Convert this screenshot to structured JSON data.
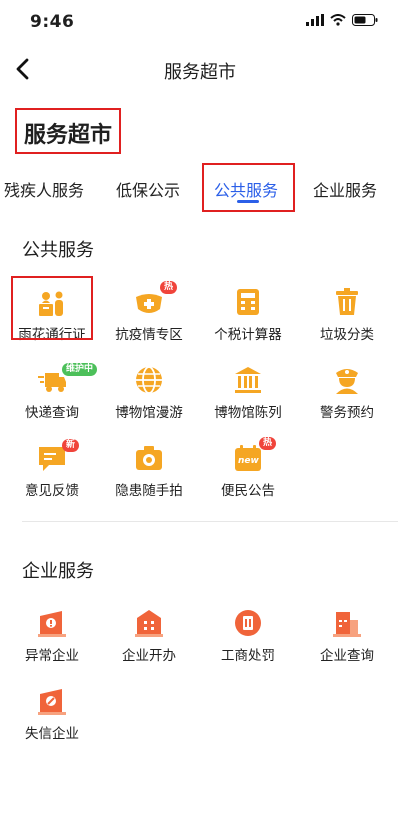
{
  "status": {
    "time": "9:46"
  },
  "nav": {
    "title": "服务超市"
  },
  "page": {
    "title": "服务超市"
  },
  "tabs": [
    {
      "label": "残疾人服务"
    },
    {
      "label": "低保公示"
    },
    {
      "label": "公共服务"
    },
    {
      "label": "企业服务"
    }
  ],
  "public": {
    "title": "公共服务",
    "items": [
      {
        "label": "雨花通行证",
        "icon": "pass-icon"
      },
      {
        "label": "抗疫情专区",
        "icon": "epidemic-icon",
        "badge": "热"
      },
      {
        "label": "个税计算器",
        "icon": "calculator-icon"
      },
      {
        "label": "垃圾分类",
        "icon": "trash-icon"
      },
      {
        "label": "快递查询",
        "icon": "delivery-icon",
        "badge": "维护中"
      },
      {
        "label": "博物馆漫游",
        "icon": "globe-icon"
      },
      {
        "label": "博物馆陈列",
        "icon": "museum-icon"
      },
      {
        "label": "警务预约",
        "icon": "police-icon"
      },
      {
        "label": "意见反馈",
        "icon": "feedback-icon",
        "badge": "新"
      },
      {
        "label": "隐患随手拍",
        "icon": "camera-icon"
      },
      {
        "label": "便民公告",
        "icon": "notice-icon",
        "badge": "热",
        "subbadge": "new"
      }
    ]
  },
  "enterprise": {
    "title": "企业服务",
    "items": [
      {
        "label": "异常企业",
        "icon": "alert-building-icon"
      },
      {
        "label": "企业开办",
        "icon": "building-icon"
      },
      {
        "label": "工商处罚",
        "icon": "penalty-icon"
      },
      {
        "label": "企业查询",
        "icon": "search-building-icon"
      },
      {
        "label": "失信企业",
        "icon": "dishonest-icon"
      }
    ]
  },
  "colors": {
    "accent": "#2b5fe8",
    "orange": "#f5a623",
    "deepOrange": "#f0643a",
    "highlight": "#e02020"
  }
}
